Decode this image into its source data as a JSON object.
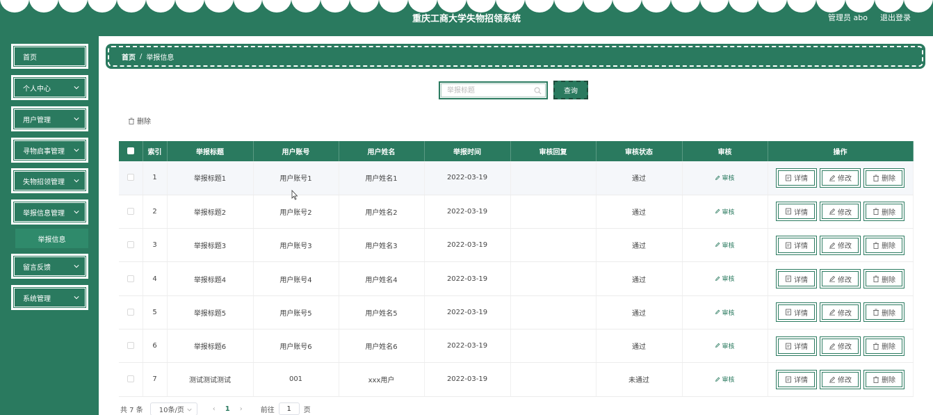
{
  "header": {
    "title": "重庆工商大学失物招领系统",
    "user": "管理员 abo",
    "logout": "退出登录"
  },
  "sidebar": {
    "items": [
      {
        "label": "首页",
        "has_arrow": false
      },
      {
        "label": "个人中心",
        "has_arrow": true
      },
      {
        "label": "用户管理",
        "has_arrow": true
      },
      {
        "label": "寻物启事管理",
        "has_arrow": true
      },
      {
        "label": "失物招领管理",
        "has_arrow": true
      },
      {
        "label": "举报信息管理",
        "has_arrow": true,
        "expanded": true
      },
      {
        "label": "留言反馈",
        "has_arrow": true
      },
      {
        "label": "系统管理",
        "has_arrow": true
      }
    ],
    "subitem": "举报信息"
  },
  "breadcrumb": {
    "home": "首页",
    "separator": "/",
    "current": "举报信息"
  },
  "search": {
    "placeholder": "举报标题",
    "button": "查询"
  },
  "toolbar": {
    "delete": "删除"
  },
  "table": {
    "headers": [
      "",
      "索引",
      "举报标题",
      "用户账号",
      "用户姓名",
      "举报时间",
      "审核回复",
      "审核状态",
      "审核",
      "操作"
    ],
    "audit_label": "审核",
    "op_labels": {
      "detail": "详情",
      "edit": "修改",
      "delete": "删除"
    },
    "rows": [
      {
        "index": "1",
        "title": "举报标题1",
        "account": "用户账号1",
        "name": "用户姓名1",
        "time": "2022-03-19",
        "reply": "",
        "status": "通过"
      },
      {
        "index": "2",
        "title": "举报标题2",
        "account": "用户账号2",
        "name": "用户姓名2",
        "time": "2022-03-19",
        "reply": "",
        "status": "通过"
      },
      {
        "index": "3",
        "title": "举报标题3",
        "account": "用户账号3",
        "name": "用户姓名3",
        "time": "2022-03-19",
        "reply": "",
        "status": "通过"
      },
      {
        "index": "4",
        "title": "举报标题4",
        "account": "用户账号4",
        "name": "用户姓名4",
        "time": "2022-03-19",
        "reply": "",
        "status": "通过"
      },
      {
        "index": "5",
        "title": "举报标题5",
        "account": "用户账号5",
        "name": "用户姓名5",
        "time": "2022-03-19",
        "reply": "",
        "status": "通过"
      },
      {
        "index": "6",
        "title": "举报标题6",
        "account": "用户账号6",
        "name": "用户姓名6",
        "time": "2022-03-19",
        "reply": "",
        "status": "通过"
      },
      {
        "index": "7",
        "title": "测试测试测试",
        "account": "001",
        "name": "xxx用户",
        "time": "2022-03-19",
        "reply": "",
        "status": "未通过"
      }
    ]
  },
  "pagination": {
    "total": "共 7 条",
    "page_size": "10条/页",
    "prev": "‹",
    "current_page": "1",
    "next": "›",
    "goto_label": "前往",
    "goto_value": "1",
    "goto_suffix": "页"
  },
  "colors": {
    "primary": "#2a7a5f",
    "header_text": "#ffffff"
  }
}
